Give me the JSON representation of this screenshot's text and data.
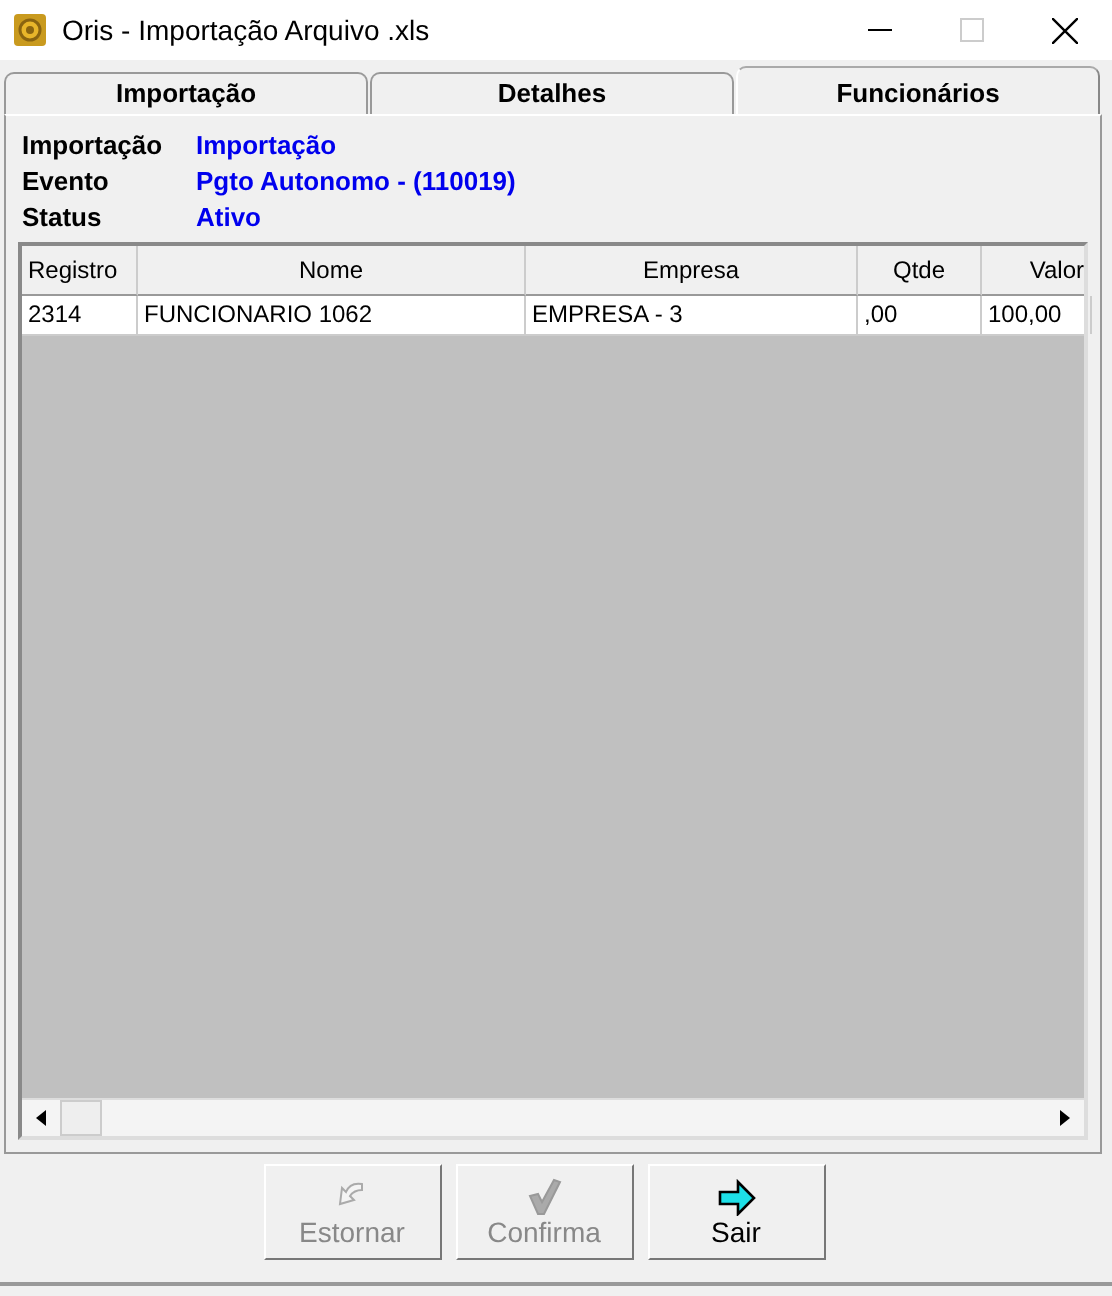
{
  "window": {
    "title": "Oris - Importação Arquivo .xls"
  },
  "tabs": [
    {
      "label": "Importação",
      "selected": false
    },
    {
      "label": "Detalhes",
      "selected": false
    },
    {
      "label": "Funcionários",
      "selected": true
    }
  ],
  "info": [
    {
      "label": "Importação",
      "value": "Importação"
    },
    {
      "label": "Evento",
      "value": "Pgto Autonomo - (110019)"
    },
    {
      "label": "Status",
      "value": "Ativo"
    }
  ],
  "table": {
    "columns": [
      "Registro",
      "Nome",
      "Empresa",
      "Qtde",
      "Valor"
    ],
    "rows": [
      [
        "2314",
        "FUNCIONARIO 1062",
        "EMPRESA - 3",
        ",00",
        "100,00"
      ]
    ]
  },
  "buttons": [
    {
      "label": "Estornar",
      "disabled": true
    },
    {
      "label": "Confirma",
      "disabled": true
    },
    {
      "label": "Sair",
      "disabled": false
    }
  ]
}
